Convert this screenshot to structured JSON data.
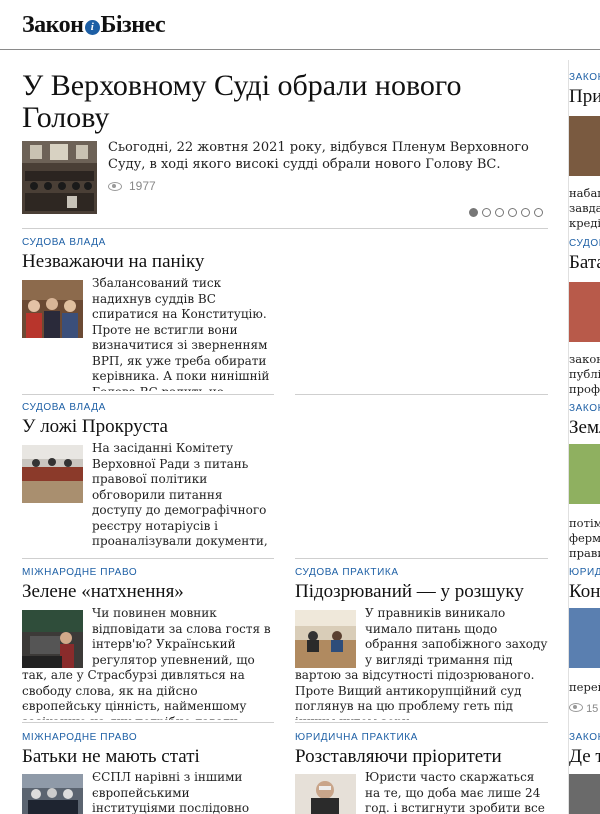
{
  "header": {
    "logo_left": "Закон",
    "logo_mark": "і",
    "logo_right": "Бізнес"
  },
  "hero": {
    "title": "У Верховному Суді обрали нового Голову",
    "text": "Сьогодні, 22 жовтня 2021 року, відбувся Пленум Верховного Суду, в ході якого високі судді обрали нового Голову ВС.",
    "views": "1977",
    "icon": "eye-icon",
    "slider_count": 6,
    "slider_active": 0
  },
  "articles": [
    {
      "category": "СУДОВА ВЛАДА",
      "title": "Незважаючи на паніку",
      "text": "Збалансований тиск надихнув суддів ВС спиратися на Конституцію. Проте не встигли вони визначитися зі зверненням ВРП, як уже треба обирати керівника. А поки нинішній Голова ВС радить не звужувати повноважень Суду, а КАС — приховати обличчя."
    },
    {
      "category": "СУДОВА ВЛАДА",
      "title": "У ложі Прокруста",
      "text": "На засіданні Комітету Верховної Ради з питань правової політики обговорили питання доступу до демографічного реєстру нотаріусів і проаналізували документи, подані кандидатами в члени ВРП."
    },
    {
      "category": "МІЖНАРОДНЕ ПРАВО",
      "title": "Зелене «натхнення»",
      "text": "Чи повинен мовник відповідати за слова гостя в інтерв'ю? Український регулятор упевнений, що так, але у Страсбурзі дивляться на свободу слова, як на дійсно європейську цінність, найменшому зазіханню на яку потрібно давати відсіч."
    },
    {
      "category": "СУДОВА ПРАКТИКА",
      "title": "Підозрюваний — у розшуку",
      "text": "У правників виникало чимало питань щодо обрання запобіжного заходу у вигляді тримання під вартою за відсутності підозрюваного. Проте Вищий антикорупційний суд поглянув на цю проблему геть під іншим кутом зору."
    },
    {
      "category": "МІЖНАРОДНЕ ПРАВО",
      "title": "Батьки не мають статі",
      "text": "ЄСПЛ нарівні з іншими європейськими інституціями послідовно відстоює рівність"
    },
    {
      "category": "ЮРИДИЧНА ПРАКТИКА",
      "title": "Розставляючи пріоритети",
      "text": "Юристи часто скаржаться на те, що доба має лише 24 год. і встигнути зробити все"
    }
  ],
  "right_column": [
    {
      "category": "ЗАКОН",
      "title": "При",
      "text": [
        "набаг",
        "завда",
        "креді"
      ]
    },
    {
      "category": "СУДОВ",
      "title": "Бата",
      "text": [
        "закон",
        "публі",
        "профе"
      ]
    },
    {
      "category": "ЗАКОН",
      "title": "Земл",
      "text": [
        "потім",
        "ферме",
        "прави"
      ]
    },
    {
      "category": "ЮРИДИ",
      "title": "Конь",
      "text": [
        "перей"
      ],
      "views": "15"
    },
    {
      "category": "ЗАКОН",
      "title": "Де т",
      "text": []
    }
  ],
  "colors": {
    "accent": "#1d5fa5",
    "divider": "#cfcfcf"
  }
}
